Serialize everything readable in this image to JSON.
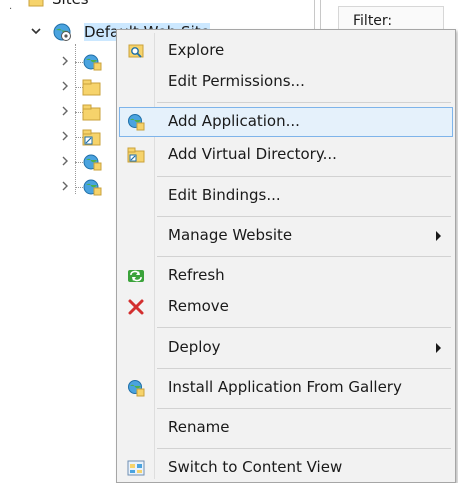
{
  "tree": {
    "sites_label": "Sites",
    "default_site_label": "Default Web Site"
  },
  "right_pane": {
    "filter_label": "Filter:"
  },
  "menu": {
    "items": [
      {
        "label": "Explore",
        "icon": "explore-icon"
      },
      {
        "label": "Edit Permissions...",
        "icon": ""
      },
      {
        "label": "Add Application...",
        "icon": "add-application-icon",
        "highlighted": true
      },
      {
        "label": "Add Virtual Directory...",
        "icon": "add-virtual-directory-icon"
      },
      {
        "label": "Edit Bindings...",
        "icon": ""
      },
      {
        "label": "Manage Website",
        "icon": "",
        "submenu": true
      },
      {
        "label": "Refresh",
        "icon": "refresh-icon"
      },
      {
        "label": "Remove",
        "icon": "remove-icon"
      },
      {
        "label": "Deploy",
        "icon": "",
        "submenu": true
      },
      {
        "label": "Install Application From Gallery",
        "icon": "gallery-icon"
      },
      {
        "label": "Rename",
        "icon": ""
      },
      {
        "label": "Switch to Content View",
        "icon": "content-view-icon"
      }
    ]
  },
  "colors": {
    "menu_background": "#f2f2f2",
    "highlight_fill": "#e5f1fb",
    "highlight_border": "#7eb4ea",
    "remove_red": "#d32f2f",
    "refresh_green": "#3aa33a",
    "folder_yellow": "#f6d36b"
  }
}
